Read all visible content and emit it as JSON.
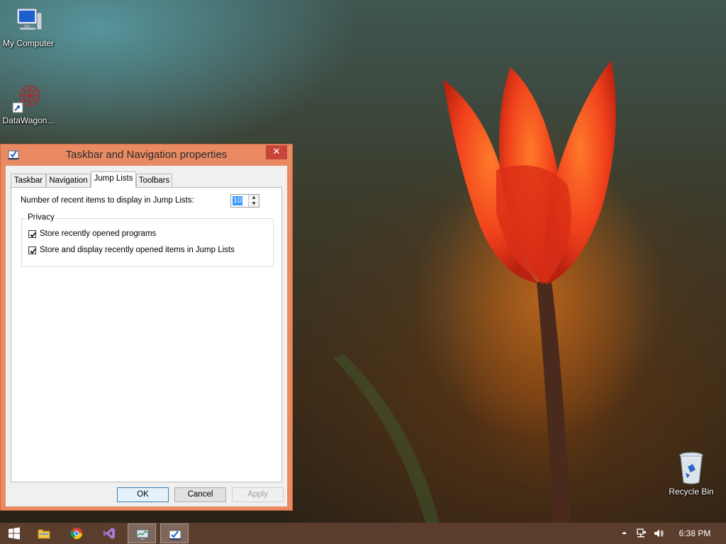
{
  "desktop": {
    "icons": [
      {
        "label": "My Computer",
        "icon": "computer-icon"
      },
      {
        "label": "DataWagon...",
        "icon": "datawagon-shortcut-icon"
      },
      {
        "label": "Recycle Bin",
        "icon": "recycle-bin-icon"
      }
    ]
  },
  "dialog": {
    "title": "Taskbar and Navigation properties",
    "close_label": "✕",
    "tabs": [
      {
        "label": "Taskbar",
        "active": false
      },
      {
        "label": "Navigation",
        "active": false
      },
      {
        "label": "Jump Lists",
        "active": true
      },
      {
        "label": "Toolbars",
        "active": false
      }
    ],
    "recent_items_label": "Number of recent items to display in Jump Lists:",
    "recent_items_value": "10",
    "privacy": {
      "group_label": "Privacy",
      "options": [
        {
          "label": "Store recently opened programs",
          "checked": true
        },
        {
          "label": "Store and display recently opened items in Jump Lists",
          "checked": true
        }
      ]
    },
    "buttons": {
      "ok": "OK",
      "cancel": "Cancel",
      "apply": "Apply"
    }
  },
  "taskbar": {
    "items": [
      {
        "icon": "start-windows-icon",
        "open": false
      },
      {
        "icon": "file-explorer-icon",
        "open": false
      },
      {
        "icon": "chrome-icon",
        "open": false
      },
      {
        "icon": "visual-studio-icon",
        "open": false
      },
      {
        "icon": "system-monitor-icon",
        "open": true
      },
      {
        "icon": "taskbar-properties-icon",
        "open": true
      }
    ],
    "tray": {
      "icons": [
        "show-hidden-icons-arrow",
        "network-icon",
        "volume-icon"
      ],
      "clock": "6:38 PM"
    }
  },
  "colors": {
    "dialog_frame": "#e98a63",
    "close_button": "#c7453a",
    "taskbar": "#5b3d2d",
    "selection": "#3399ff"
  }
}
